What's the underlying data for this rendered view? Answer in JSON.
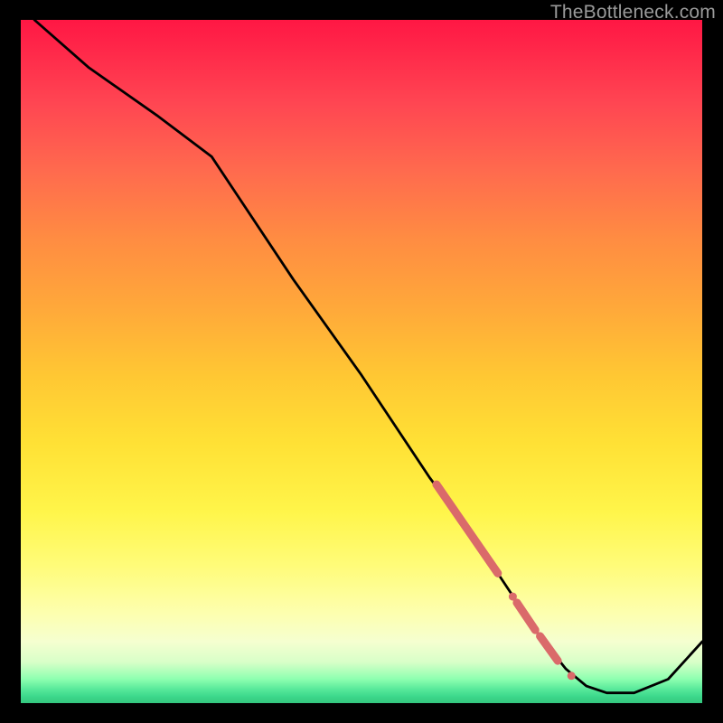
{
  "domain": "Chart",
  "watermark": "TheBottleneck.com",
  "chart_data": {
    "type": "line",
    "title": "",
    "xlabel": "",
    "ylabel": "",
    "xlim": [
      0,
      100
    ],
    "ylim": [
      0,
      100
    ],
    "series": [
      {
        "name": "curve",
        "x": [
          2,
          10,
          20,
          28,
          40,
          50,
          60,
          66,
          70,
          73,
          76,
          80,
          83,
          86,
          90,
          95,
          100
        ],
        "values": [
          100,
          93,
          86,
          80,
          62,
          48,
          33,
          25,
          19,
          14.5,
          10,
          5,
          2.5,
          1.5,
          1.5,
          3.5,
          9
        ],
        "color": "#000000",
        "stroke_width": 2.8
      }
    ],
    "markers": [
      {
        "type": "segment",
        "x1": 61,
        "y1": 32,
        "x2": 70,
        "y2": 19,
        "color": "#da6a6a",
        "width": 9
      },
      {
        "type": "dot",
        "x": 72.2,
        "y": 15.6,
        "r": 4.5,
        "color": "#da6a6a"
      },
      {
        "type": "segment",
        "x1": 72.8,
        "y1": 14.7,
        "x2": 75.5,
        "y2": 10.7,
        "color": "#da6a6a",
        "width": 9
      },
      {
        "type": "segment",
        "x1": 76.2,
        "y1": 9.8,
        "x2": 78.8,
        "y2": 6.2,
        "color": "#da6a6a",
        "width": 9
      },
      {
        "type": "dot",
        "x": 80.8,
        "y": 4.0,
        "r": 4.5,
        "color": "#da6a6a"
      }
    ]
  }
}
